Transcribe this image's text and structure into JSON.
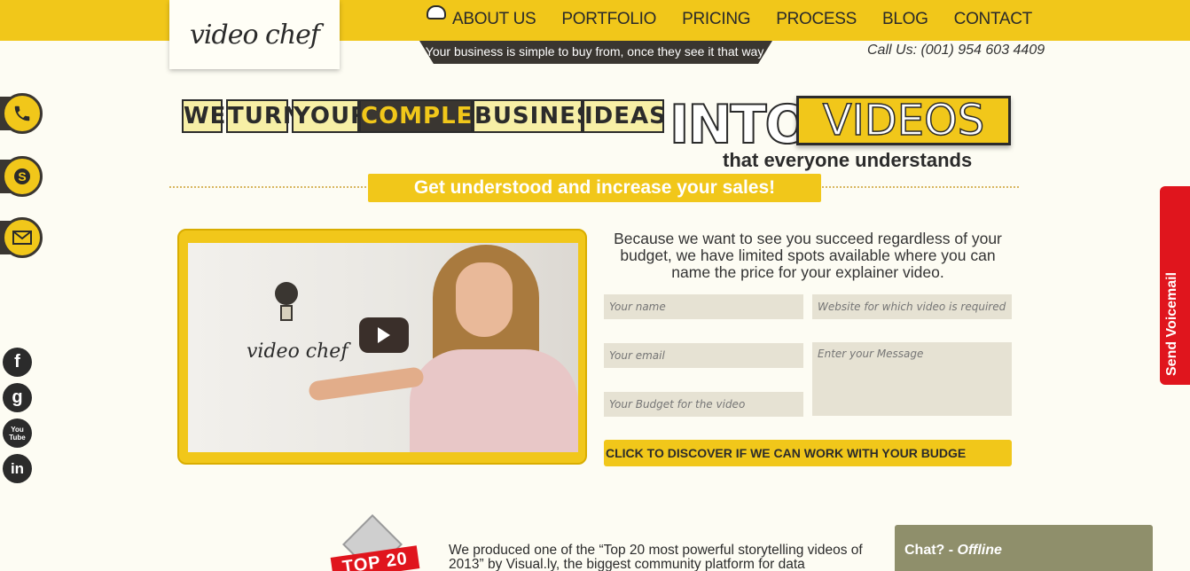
{
  "brand": {
    "logo_text": "video chef"
  },
  "nav": {
    "items": [
      {
        "label": "ABOUT US"
      },
      {
        "label": "PORTFOLIO"
      },
      {
        "label": "PRICING"
      },
      {
        "label": "PROCESS"
      },
      {
        "label": "BLOG"
      },
      {
        "label": "CONTACT"
      }
    ]
  },
  "tagline": "Your business is simple to buy from, once they see it that way.",
  "call_us": "Call Us: (001) 954 603 4409",
  "headline": {
    "words": [
      "WE",
      "TURN",
      "YOUR",
      "COMPLEX",
      "BUSINESS",
      "IDEAS"
    ],
    "into": "INTO",
    "videos": "VIDEOS",
    "sub": "that everyone understands",
    "cta_strip": "Get understood and increase your sales!"
  },
  "video": {
    "logo_text": "video chef"
  },
  "form": {
    "intro": "Because we want to see you succeed regardless of your budget, we have limited spots available where you can name the price for your explainer video.",
    "name_placeholder": "Your name",
    "website_placeholder": "Website for which video is required",
    "email_placeholder": "Your email",
    "message_placeholder": "Enter your Message",
    "budget_placeholder": "Your Budget for the video",
    "submit_label": "CLICK TO DISCOVER IF WE CAN WORK WITH YOUR BUDGE"
  },
  "voicemail": {
    "label": "Send Voicemail"
  },
  "award": {
    "ribbon": "TOP 20"
  },
  "bottom_text": "We produced one of the “Top 20 most powerful storytelling videos of 2013” by Visual.ly, the biggest community platform for data",
  "chat": {
    "label": "Chat?",
    "status": "Offline"
  },
  "social": [
    "f",
    "g",
    "You Tube",
    "in"
  ],
  "colors": {
    "accent": "#f1c71a",
    "dark": "#3a3631",
    "voicemail": "#e0151d"
  }
}
